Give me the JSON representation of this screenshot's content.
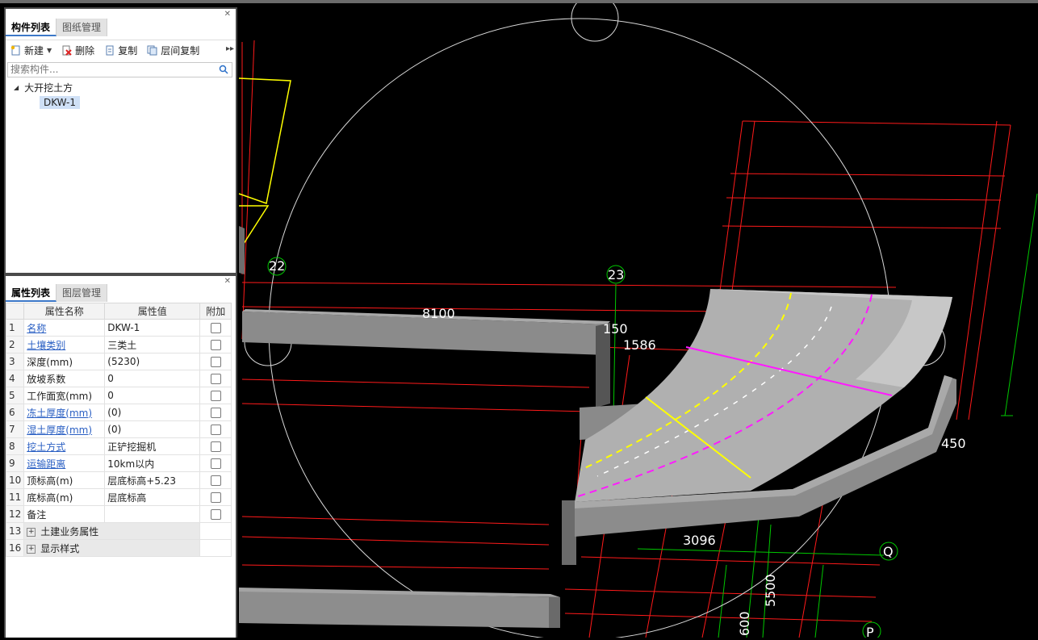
{
  "components_panel": {
    "tabs": [
      "构件列表",
      "图纸管理"
    ],
    "toolbar": {
      "new": "新建",
      "delete": "删除",
      "copy": "复制",
      "floor_copy": "层间复制"
    },
    "search_placeholder": "搜索构件...",
    "tree": {
      "category": "大开挖土方",
      "item": "DKW-1"
    }
  },
  "properties_panel": {
    "tabs": [
      "属性列表",
      "图层管理"
    ],
    "headers": {
      "name": "属性名称",
      "value": "属性值",
      "extra": "附加"
    },
    "rows": [
      {
        "num": "1",
        "name": "名称",
        "value": "DKW-1"
      },
      {
        "num": "2",
        "name": "土壤类别",
        "value": "三类土"
      },
      {
        "num": "3",
        "name": "深度(mm)",
        "value": "(5230)"
      },
      {
        "num": "4",
        "name": "放坡系数",
        "value": "0"
      },
      {
        "num": "5",
        "name": "工作面宽(mm)",
        "value": "0"
      },
      {
        "num": "6",
        "name": "冻土厚度(mm)",
        "value": "(0)"
      },
      {
        "num": "7",
        "name": "湿土厚度(mm)",
        "value": "(0)"
      },
      {
        "num": "8",
        "name": "挖土方式",
        "value": "正铲挖掘机"
      },
      {
        "num": "9",
        "name": "运输距离",
        "value": "10km以内"
      },
      {
        "num": "10",
        "name": "顶标高(m)",
        "value": "层底标高+5.23"
      },
      {
        "num": "11",
        "name": "底标高(m)",
        "value": "层底标高"
      },
      {
        "num": "12",
        "name": "备注",
        "value": ""
      }
    ],
    "groups": [
      {
        "num": "13",
        "name": "土建业务属性"
      },
      {
        "num": "16",
        "name": "显示样式"
      }
    ]
  },
  "viewport": {
    "axis_labels": {
      "a22": "22",
      "a23": "23",
      "q": "Q",
      "p": "P"
    },
    "dims": {
      "d8100": "8100",
      "d150": "150",
      "d1586": "1586",
      "d450": "450",
      "d3096": "3096",
      "d5500": "5500",
      "d600": "600"
    }
  },
  "colors": {
    "grid_red": "#ff1a1a",
    "grid_green": "#00c800",
    "yellow": "#ffff00",
    "magenta": "#ff1aff",
    "solid": "#8e8e8e"
  }
}
